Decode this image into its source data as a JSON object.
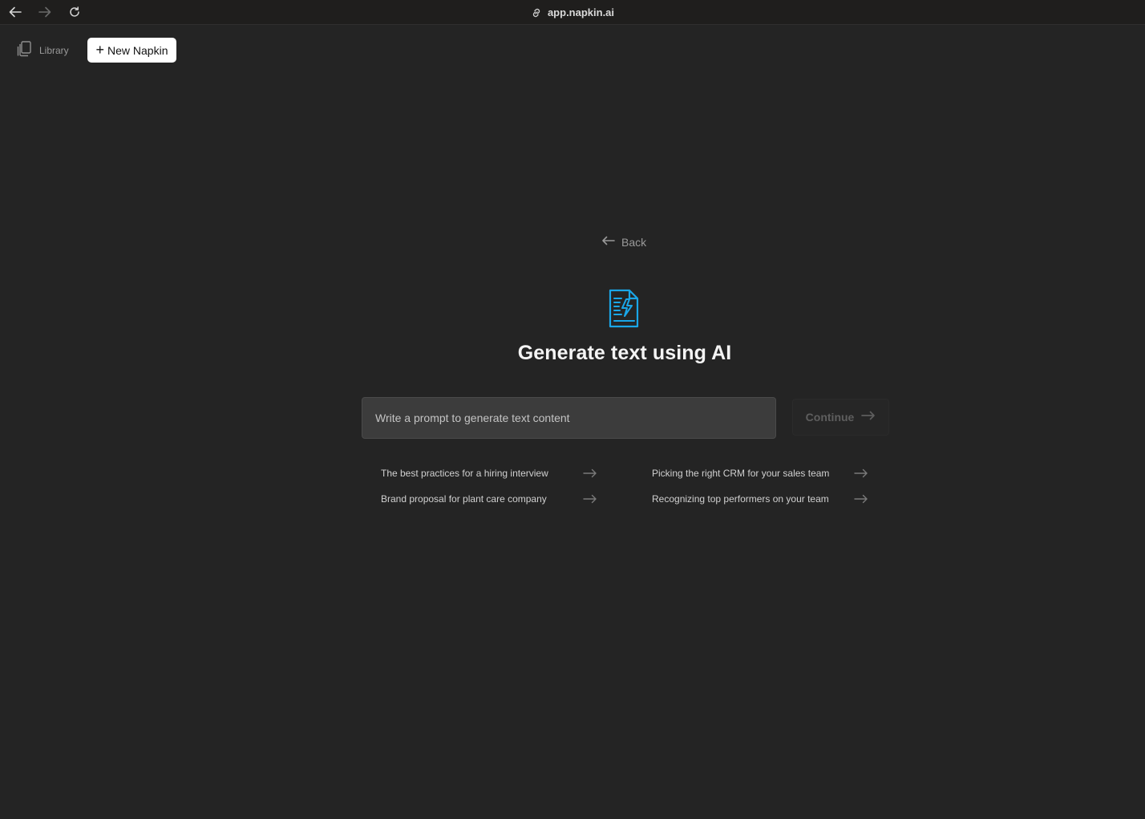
{
  "browser": {
    "url": "app.napkin.ai",
    "back_icon": "arrow-left-icon",
    "forward_icon": "arrow-right-icon",
    "reload_icon": "reload-icon",
    "link_icon": "link-icon"
  },
  "toolbar": {
    "library_label": "Library",
    "library_icon": "library-stack-icon",
    "new_napkin_label": "New Napkin",
    "new_napkin_icon": "plus-icon"
  },
  "main": {
    "back_label": "Back",
    "icon": "ai-document-icon",
    "title": "Generate text using AI",
    "prompt_placeholder": "Write a prompt to generate text content",
    "prompt_value": "",
    "continue_label": "Continue",
    "suggestions": [
      {
        "label": "The best practices for a hiring interview"
      },
      {
        "label": "Picking the right CRM for your sales team"
      },
      {
        "label": "Brand proposal for plant care company"
      },
      {
        "label": "Recognizing top performers on your team"
      }
    ]
  },
  "colors": {
    "background": "#242424",
    "accent_icon": "#1aa6e8",
    "input_bg": "#3c3c3c"
  }
}
